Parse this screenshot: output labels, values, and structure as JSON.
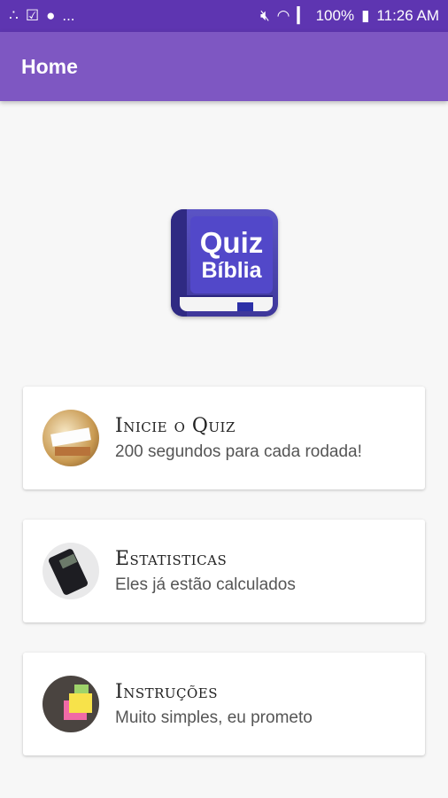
{
  "status_bar": {
    "left_icons": [
      "share-icon",
      "clipboard-icon",
      "info-icon"
    ],
    "left_overflow": "...",
    "battery": "100%",
    "time": "11:26 AM"
  },
  "app_bar": {
    "title": "Home"
  },
  "logo": {
    "line1": "Quiz",
    "line2": "Bíblia"
  },
  "menu": [
    {
      "icon": "quiz-thumbnail",
      "title": "Inicie o Quiz",
      "subtitle": "200 segundos para cada rodada!"
    },
    {
      "icon": "calculator-thumbnail",
      "title": "Estatisticas",
      "subtitle": "Eles já estão calculados"
    },
    {
      "icon": "sticky-notes-thumbnail",
      "title": "Instruções",
      "subtitle": "Muito simples, eu prometo"
    }
  ],
  "colors": {
    "status_bar": "#5e35b1",
    "app_bar": "#7e57c2",
    "background": "#f7f7f7"
  }
}
